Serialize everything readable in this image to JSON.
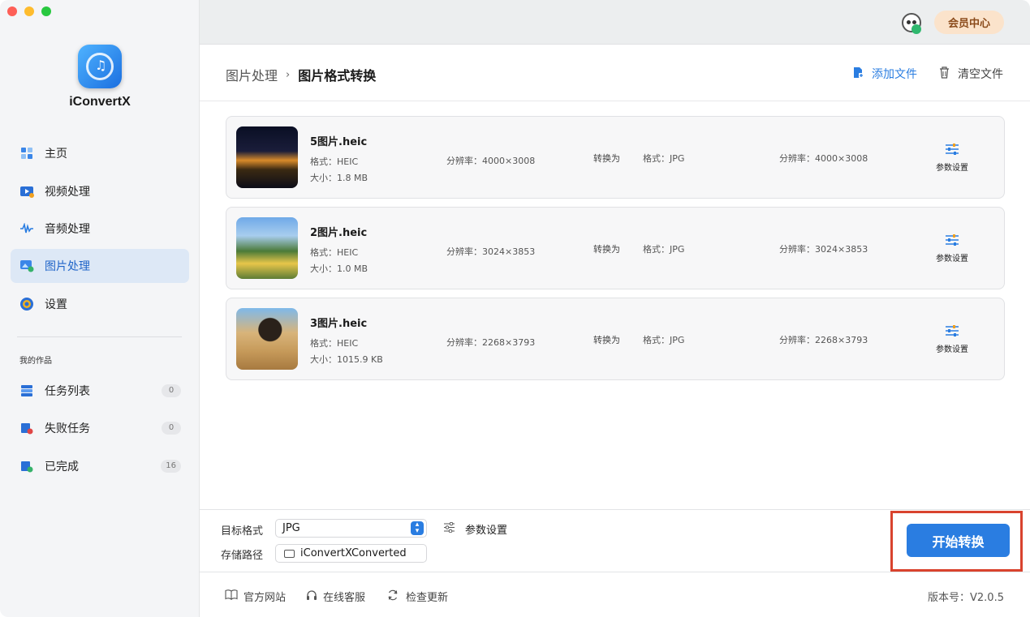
{
  "window": {
    "buttons": [
      "close",
      "minimize",
      "zoom"
    ]
  },
  "app": {
    "name": "iConvertX"
  },
  "sidebar": {
    "items": [
      {
        "label": "主页",
        "icon": "home-grid-icon"
      },
      {
        "label": "视频处理",
        "icon": "video-icon"
      },
      {
        "label": "音频处理",
        "icon": "audio-wave-icon"
      },
      {
        "label": "图片处理",
        "icon": "image-icon",
        "active": true
      },
      {
        "label": "设置",
        "icon": "gear-icon"
      }
    ],
    "section_title": "我的作品",
    "works": [
      {
        "label": "任务列表",
        "count": "0",
        "icon": "task-list-icon"
      },
      {
        "label": "失败任务",
        "count": "0",
        "icon": "failed-task-icon"
      },
      {
        "label": "已完成",
        "count": "16",
        "icon": "completed-icon"
      }
    ]
  },
  "topbar": {
    "member_label": "会员中心"
  },
  "header": {
    "breadcrumb_parent": "图片处理",
    "breadcrumb_separator": "›",
    "breadcrumb_current": "图片格式转换",
    "add_file_label": "添加文件",
    "clear_file_label": "清空文件"
  },
  "files": [
    {
      "name": "5图片.heic",
      "format": "格式：HEIC",
      "size": "大小：1.8 MB",
      "resolution": "分辨率：4000×3008",
      "convert_to": "转换为",
      "target_format": "格式：JPG",
      "target_resolution": "分辨率：4000×3008",
      "param_label": "参数设置"
    },
    {
      "name": "2图片.heic",
      "format": "格式：HEIC",
      "size": "大小：1.0 MB",
      "resolution": "分辨率：3024×3853",
      "convert_to": "转换为",
      "target_format": "格式：JPG",
      "target_resolution": "分辨率：3024×3853",
      "param_label": "参数设置"
    },
    {
      "name": "3图片.heic",
      "format": "格式：HEIC",
      "size": "大小：1015.9 KB",
      "resolution": "分辨率：2268×3793",
      "convert_to": "转换为",
      "target_format": "格式：JPG",
      "target_resolution": "分辨率：2268×3793",
      "param_label": "参数设置"
    }
  ],
  "bottom": {
    "target_format_label": "目标格式",
    "target_format_value": "JPG",
    "settings_label": "参数设置",
    "save_path_label": "存储路径",
    "save_path_value": "iConvertXConverted",
    "start_button": "开始转换"
  },
  "footer": {
    "website": "官方网站",
    "support": "在线客服",
    "update": "检查更新",
    "version": "版本号：V2.0.5"
  },
  "colors": {
    "accent": "#2a7de1",
    "highlight_outline": "#d9432e",
    "member_bg": "#fbe3cb"
  }
}
